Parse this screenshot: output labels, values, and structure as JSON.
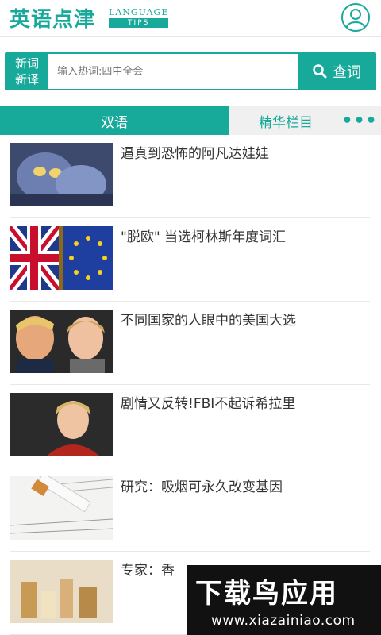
{
  "header": {
    "logo_text": "英语点津",
    "logo_sub_top": "LANGUAGE",
    "logo_sub_bottom": "TIPS"
  },
  "search": {
    "newword_label_line1": "新词",
    "newword_label_line2": "新译",
    "placeholder": "输入热词:四中全会",
    "button_label": "查词"
  },
  "tabs": {
    "bilingual": "双语",
    "featured": "精华栏目",
    "more": "•••"
  },
  "articles": [
    {
      "title": "逼真到恐怖的阿凡达娃娃"
    },
    {
      "title": "\"脱欧\" 当选柯林斯年度词汇"
    },
    {
      "title": "不同国家的人眼中的美国大选"
    },
    {
      "title": "剧情又反转!FBI不起诉希拉里"
    },
    {
      "title": "研究：吸烟可永久改变基因"
    },
    {
      "title": "专家：香"
    }
  ],
  "watermark": {
    "main": "下载鸟应用",
    "url": "www.xiazainiao.com"
  },
  "colors": {
    "accent": "#17a99a"
  }
}
